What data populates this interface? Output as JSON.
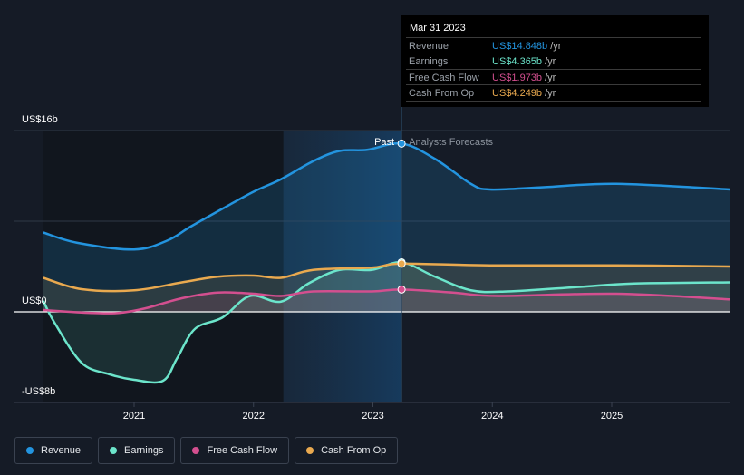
{
  "chart_data": {
    "type": "line",
    "title": "",
    "ylabel": "",
    "xlabel": "",
    "ylim": [
      -8,
      16
    ],
    "xlim": [
      2020.24,
      2025.99
    ],
    "y_tick_labels": [
      "US$16b",
      "US$0",
      "-US$8b"
    ],
    "y_ticks": [
      16,
      0,
      -8
    ],
    "x_ticks": [
      2021,
      2022,
      2023,
      2024,
      2025
    ],
    "x_tick_labels": [
      "2021",
      "2022",
      "2023",
      "2024",
      "2025"
    ],
    "past_label": "Past",
    "forecast_label": "Analysts Forecasts",
    "past_end": 2023.24,
    "highlight_start": 2022.25,
    "series": [
      {
        "name": "Revenue",
        "color": "#2394df",
        "x": [
          2020.24,
          2020.52,
          2021.0,
          2021.28,
          2021.47,
          2021.74,
          2022.0,
          2022.23,
          2022.5,
          2022.72,
          2022.95,
          2023.24,
          2023.52,
          2023.82,
          2023.98,
          2024.43,
          2025.04,
          2025.99
        ],
        "values": [
          7.0,
          6.1,
          5.5,
          6.3,
          7.5,
          9.1,
          10.6,
          11.7,
          13.3,
          14.2,
          14.3,
          14.85,
          13.5,
          11.3,
          10.8,
          11.0,
          11.3,
          10.8
        ]
      },
      {
        "name": "Earnings",
        "color": "#6ce5cb",
        "x": [
          2020.24,
          2020.33,
          2020.56,
          2020.79,
          2021.0,
          2021.24,
          2021.36,
          2021.51,
          2021.74,
          2021.97,
          2022.23,
          2022.46,
          2022.72,
          2022.99,
          2023.24,
          2023.52,
          2023.82,
          2024.13,
          2024.73,
          2025.19,
          2025.99
        ],
        "values": [
          0.96,
          -0.9,
          -4.5,
          -5.5,
          -6.0,
          -6.1,
          -4.1,
          -1.5,
          -0.5,
          1.4,
          0.9,
          2.5,
          3.7,
          3.7,
          4.365,
          3.1,
          1.9,
          1.8,
          2.2,
          2.5,
          2.6
        ]
      },
      {
        "name": "Free Cash Flow",
        "color": "#d34f8f",
        "x": [
          2020.24,
          2020.64,
          2020.87,
          2021.09,
          2021.4,
          2021.7,
          2022.0,
          2022.23,
          2022.5,
          2022.99,
          2023.24,
          2023.67,
          2024.05,
          2025.04,
          2025.99
        ],
        "values": [
          0.16,
          -0.1,
          -0.1,
          0.3,
          1.2,
          1.7,
          1.6,
          1.4,
          1.8,
          1.8,
          1.973,
          1.7,
          1.4,
          1.6,
          1.1
        ]
      },
      {
        "name": "Cash From Op",
        "color": "#e9a94f",
        "x": [
          2020.24,
          2020.56,
          2021.0,
          2021.4,
          2021.7,
          2022.0,
          2022.23,
          2022.5,
          2022.99,
          2023.24,
          2023.98,
          2025.04,
          2025.99
        ],
        "values": [
          3.0,
          2.0,
          1.9,
          2.6,
          3.1,
          3.2,
          3.0,
          3.7,
          3.9,
          4.249,
          4.1,
          4.1,
          4.0
        ]
      }
    ],
    "tooltip": {
      "date": "Mar 31 2023",
      "unit": "/yr",
      "rows": [
        {
          "label": "Revenue",
          "value": "US$14.848b",
          "color": "#2394df"
        },
        {
          "label": "Earnings",
          "value": "US$4.365b",
          "color": "#6ce5cb"
        },
        {
          "label": "Free Cash Flow",
          "value": "US$1.973b",
          "color": "#d34f8f"
        },
        {
          "label": "Cash From Op",
          "value": "US$4.249b",
          "color": "#e9a94f"
        }
      ]
    },
    "legend": [
      "Revenue",
      "Earnings",
      "Free Cash Flow",
      "Cash From Op"
    ],
    "legend_placement": "bottom-left"
  }
}
